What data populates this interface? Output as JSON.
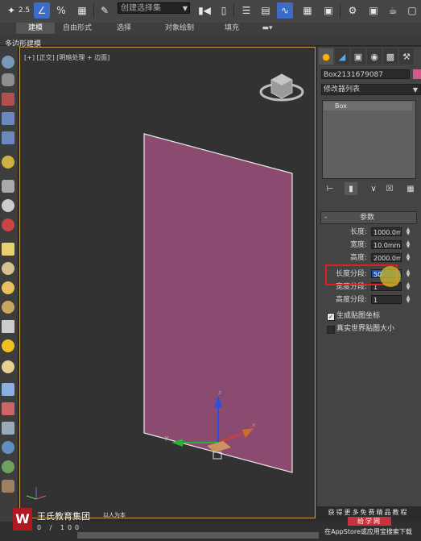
{
  "toolbar": {
    "snap_label": "2.5",
    "angle_snap_label": "∠",
    "percent_snap_label": "%",
    "spinner_snap_label": "%",
    "selection_set_placeholder": "创建选择集",
    "icons": [
      "snaps-toggle-icon",
      "angle-snap-icon",
      "percent-snap-icon",
      "spinner-snap-icon",
      "edit-named-selection-icon",
      "mirror-icon",
      "align-icon",
      "layer-manager-icon",
      "graphite-toggle-icon",
      "curve-editor-icon",
      "schematic-view-icon",
      "material-editor-icon",
      "render-setup-icon",
      "rendered-frame-icon",
      "render-icon",
      "render-iterative-icon"
    ]
  },
  "ribbon": {
    "tabs": [
      "建模",
      "自由形式",
      "选择",
      "对象绘制",
      "填充"
    ],
    "active": "建模",
    "sub_label": "多边形建模"
  },
  "viewport": {
    "label": "[+] [正交] [明暗处理 + 边面]",
    "plane_color": "#8b4a70",
    "gizmo_axes": [
      "x",
      "y",
      "z"
    ]
  },
  "command_panel": {
    "tabs": [
      "create-tab",
      "modify-tab",
      "hierarchy-tab",
      "motion-tab",
      "display-tab",
      "utilities-tab"
    ],
    "object_name": "Box2131679087",
    "object_color": "#d4588e",
    "modifier_list": "修改器列表",
    "stack": [
      "Box"
    ],
    "stack_tools": [
      "pin-stack-icon",
      "show-end-result-icon",
      "make-unique-icon",
      "remove-modifier-icon",
      "configure-sets-icon"
    ]
  },
  "params": {
    "title": "参数",
    "minus": "-",
    "rows": [
      {
        "label": "长度:",
        "value": "1000.0mm"
      },
      {
        "label": "宽度:",
        "value": "10.0mm"
      },
      {
        "label": "高度:",
        "value": "2000.0mm"
      },
      {
        "label": "长度分段:",
        "value": "50"
      },
      {
        "label": "宽度分段:",
        "value": "1"
      },
      {
        "label": "高度分段:",
        "value": "1"
      }
    ],
    "gen_mapping_label": "生成贴图坐标",
    "gen_mapping_checked": true,
    "real_world_label": "真实世界贴图大小",
    "real_world_checked": false
  },
  "watermark": {
    "logo_letter": "W",
    "company": "王氏教育集团",
    "slogan": "以人为本",
    "bottom_text": "0 / 100"
  },
  "promo": {
    "line1": "获得更多免费精品教程",
    "badge": "给学网",
    "line3": "在AppStore或应用宝搜索下载"
  }
}
